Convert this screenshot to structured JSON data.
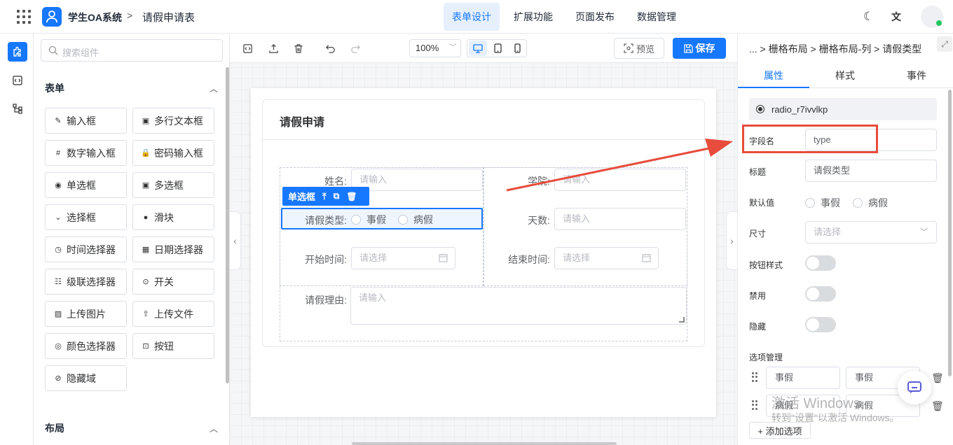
{
  "header": {
    "app_name": "学生OA系统",
    "breadcrumb_sep": ">",
    "form_name": "请假申请表",
    "nav": [
      "表单设计",
      "扩展功能",
      "页面发布",
      "数据管理"
    ],
    "active_nav_index": 0,
    "theme_icon": "moon-icon",
    "translate_icon": "translate-icon"
  },
  "rail": {
    "items": [
      "puzzle-icon",
      "code-icon",
      "tree-icon"
    ]
  },
  "palette": {
    "search_placeholder": "搜索组件",
    "form_section": "表单",
    "layout_section": "布局",
    "components": [
      {
        "label": "输入框",
        "icon": "pencil-icon"
      },
      {
        "label": "多行文本框",
        "icon": "textarea-icon"
      },
      {
        "label": "数字输入框",
        "icon": "number-icon"
      },
      {
        "label": "密码输入框",
        "icon": "lock-icon"
      },
      {
        "label": "单选框",
        "icon": "radio-icon"
      },
      {
        "label": "多选框",
        "icon": "checkbox-icon"
      },
      {
        "label": "选择框",
        "icon": "select-icon"
      },
      {
        "label": "滑块",
        "icon": "slider-icon"
      },
      {
        "label": "时间选择器",
        "icon": "clock-icon"
      },
      {
        "label": "日期选择器",
        "icon": "calendar-icon"
      },
      {
        "label": "级联选择器",
        "icon": "cascader-icon"
      },
      {
        "label": "开关",
        "icon": "switch-icon"
      },
      {
        "label": "上传图片",
        "icon": "image-icon"
      },
      {
        "label": "上传文件",
        "icon": "upload-icon"
      },
      {
        "label": "颜色选择器",
        "icon": "palette-icon"
      },
      {
        "label": "按钮",
        "icon": "button-icon"
      },
      {
        "label": "隐藏域",
        "icon": "eye-off-icon"
      }
    ]
  },
  "toolbar": {
    "zoom": "100%",
    "preview_label": "预览",
    "save_label": "保存",
    "active_device": "desktop"
  },
  "form": {
    "title": "请假申请",
    "fields": {
      "name_label": "姓名:",
      "name_placeholder": "请输入",
      "college_label": "学院:",
      "college_placeholder": "请输入",
      "leave_type_label": "请假类型:",
      "leave_type_options": [
        "事假",
        "病假"
      ],
      "days_label": "天数:",
      "days_placeholder": "请输入",
      "start_label": "开始时间:",
      "start_placeholder": "请选择",
      "end_label": "结束时间:",
      "end_placeholder": "请选择",
      "reason_label": "请假理由:",
      "reason_placeholder": "请输入"
    },
    "selected_tag": "单选框"
  },
  "props": {
    "breadcrumb": "... > 栅格布局 > 栅格布局-列 > 请假类型",
    "tabs": [
      "属性",
      "样式",
      "事件"
    ],
    "active_tab_index": 0,
    "component_id": "radio_r7ivvlkp",
    "field_name_label": "字段名",
    "field_name_value": "type",
    "title_label": "标题",
    "title_value": "请假类型",
    "default_label": "默认值",
    "default_options": [
      "事假",
      "病假"
    ],
    "size_label": "尺寸",
    "size_placeholder": "请选择",
    "button_style_label": "按钮样式",
    "disabled_label": "禁用",
    "hidden_label": "隐藏",
    "button_style_on": false,
    "disabled_on": false,
    "hidden_on": false,
    "options_label": "选项管理",
    "options": [
      {
        "label": "事假",
        "value": "事假"
      },
      {
        "label": "病假",
        "value": "病假"
      }
    ],
    "add_option_label": "+ 添加选项"
  },
  "watermark": {
    "line1": "激活 Windows",
    "line2": "转到\"设置\"以激活 Windows。"
  },
  "colors": {
    "primary": "#1677ff",
    "annotation": "#e74c3c"
  }
}
